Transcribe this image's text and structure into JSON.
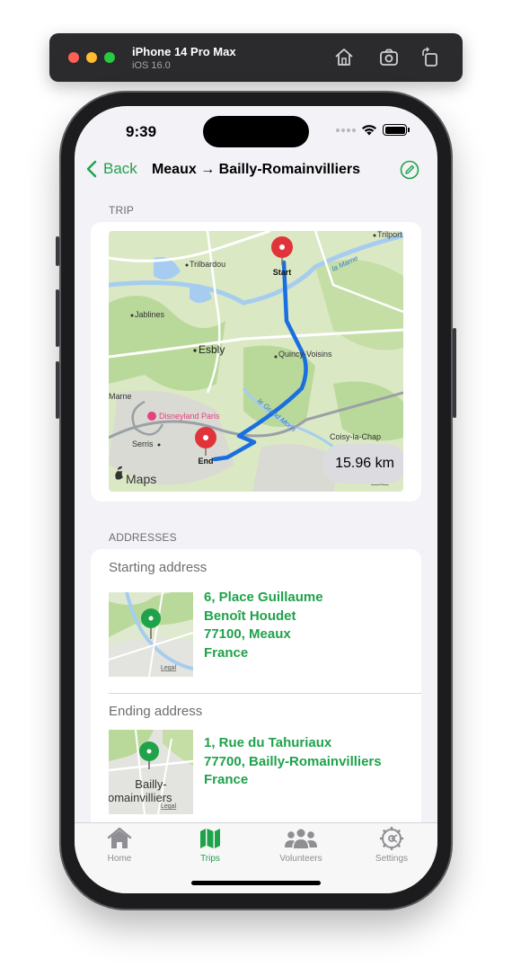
{
  "simulator": {
    "device_name": "iPhone 14 Pro Max",
    "os_version": "iOS 16.0",
    "buttons": [
      "home-icon",
      "screenshot-icon",
      "rotate-icon"
    ]
  },
  "status_bar": {
    "time": "9:39"
  },
  "nav": {
    "back_label": "Back",
    "title": "Meaux → Bailly-Romainvilliers",
    "edit_icon": "edit-circle-icon"
  },
  "trip": {
    "section_title": "TRIP",
    "start_pin_label": "Start",
    "end_pin_label": "End",
    "distance": "15.96 km",
    "map_labels": {
      "triltop": "Trilport",
      "trilbardou": "Trilbardou",
      "jablines": "Jablines",
      "esbly": "Esbly",
      "quincy": "Quincy-Voisins",
      "marne": "Marne",
      "disneyland": "Disneyland Paris",
      "serris": "Serris",
      "chap": "Coisy-la-Chap",
      "grand_morin": "le Grand Morin",
      "la_marne": "la Marne",
      "maps_logo": "Maps",
      "legal": "Legal"
    }
  },
  "addresses": {
    "section_title": "ADDRESSES",
    "starting": {
      "label": "Starting address",
      "lines": [
        "6, Place Guillaume",
        "Benoît Houdet",
        "77100, Meaux",
        "France"
      ],
      "legal": "Legal"
    },
    "ending": {
      "label": "Ending address",
      "lines": [
        "1, Rue du Tahuriaux",
        "77700, Bailly-Romainvilliers",
        "France"
      ],
      "thumb_label_1": "Bailly-",
      "thumb_label_2": "omainvilliers",
      "legal": "Legal"
    }
  },
  "tabs": [
    {
      "label": "Home",
      "icon": "house-icon"
    },
    {
      "label": "Trips",
      "icon": "map-icon"
    },
    {
      "label": "Volunteers",
      "icon": "people-icon"
    },
    {
      "label": "Settings",
      "icon": "gear-icon"
    }
  ],
  "colors": {
    "accent": "#1fa24a",
    "route": "#1a6fe0",
    "pin": "#e0343a"
  }
}
